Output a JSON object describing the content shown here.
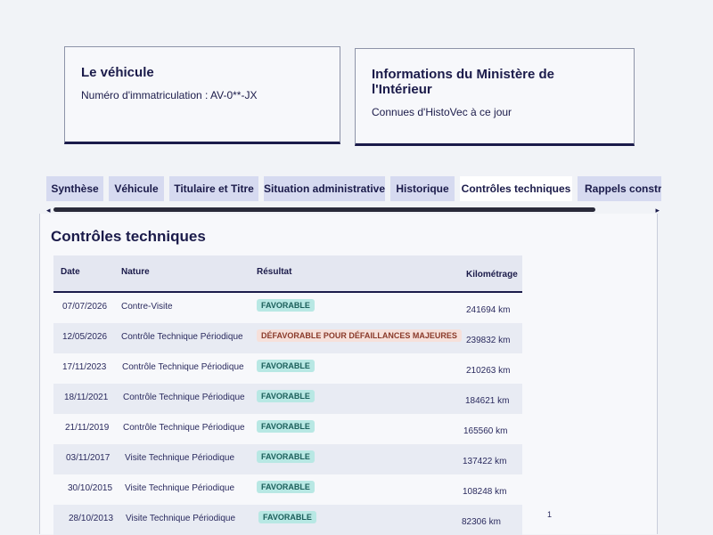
{
  "vehicle_card": {
    "title": "Le véhicule",
    "plate_label": "Numéro d'immatriculation : AV-0**-JX"
  },
  "ministry_card": {
    "title": "Informations du Ministère de l'Intérieur",
    "subtitle": "Connues d'HistoVec à ce jour"
  },
  "tabs": [
    {
      "label": "Synthèse"
    },
    {
      "label": "Véhicule"
    },
    {
      "label": "Titulaire et Titre"
    },
    {
      "label": "Situation administrative"
    },
    {
      "label": "Historique"
    },
    {
      "label": "Contrôles techniques",
      "active": true
    },
    {
      "label": "Rappels constructeur"
    }
  ],
  "scrollbar": {
    "left_arrow": "◂",
    "right_arrow": "▸"
  },
  "section": {
    "title": "Contrôles techniques"
  },
  "table": {
    "headers": {
      "date": "Date",
      "nature": "Nature",
      "result": "Résultat",
      "mileage": "Kilométrage"
    },
    "rows": [
      {
        "date": "07/07/2026",
        "nature": "Contre-Visite",
        "result": "FAVORABLE",
        "status": "ok",
        "km": "241694 km"
      },
      {
        "date": "12/05/2026",
        "nature": "Contrôle Technique Périodique",
        "result": "DÉFAVORABLE POUR DÉFAILLANCES MAJEURES",
        "status": "ko",
        "km": "239832 km"
      },
      {
        "date": "17/11/2023",
        "nature": "Contrôle Technique Périodique",
        "result": "FAVORABLE",
        "status": "ok",
        "km": "210263 km"
      },
      {
        "date": "18/11/2021",
        "nature": "Contrôle Technique Périodique",
        "result": "FAVORABLE",
        "status": "ok",
        "km": "184621 km"
      },
      {
        "date": "21/11/2019",
        "nature": "Contrôle Technique Périodique",
        "result": "FAVORABLE",
        "status": "ok",
        "km": "165560 km"
      },
      {
        "date": "03/11/2017",
        "nature": "Visite Technique Périodique",
        "result": "FAVORABLE",
        "status": "ok",
        "km": "137422 km"
      },
      {
        "date": "30/10/2015",
        "nature": "Visite Technique Périodique",
        "result": "FAVORABLE",
        "status": "ok",
        "km": "108248 km"
      },
      {
        "date": "28/10/2013",
        "nature": "Visite Technique Périodique",
        "result": "FAVORABLE",
        "status": "ok",
        "km": "82306 km"
      }
    ]
  },
  "footer_mark": "1",
  "colors": {
    "primary": "#1b1b4a",
    "tab_bg": "#d6daf0",
    "badge_ok": "#b8e8e4",
    "badge_ko": "#f6e0da"
  }
}
